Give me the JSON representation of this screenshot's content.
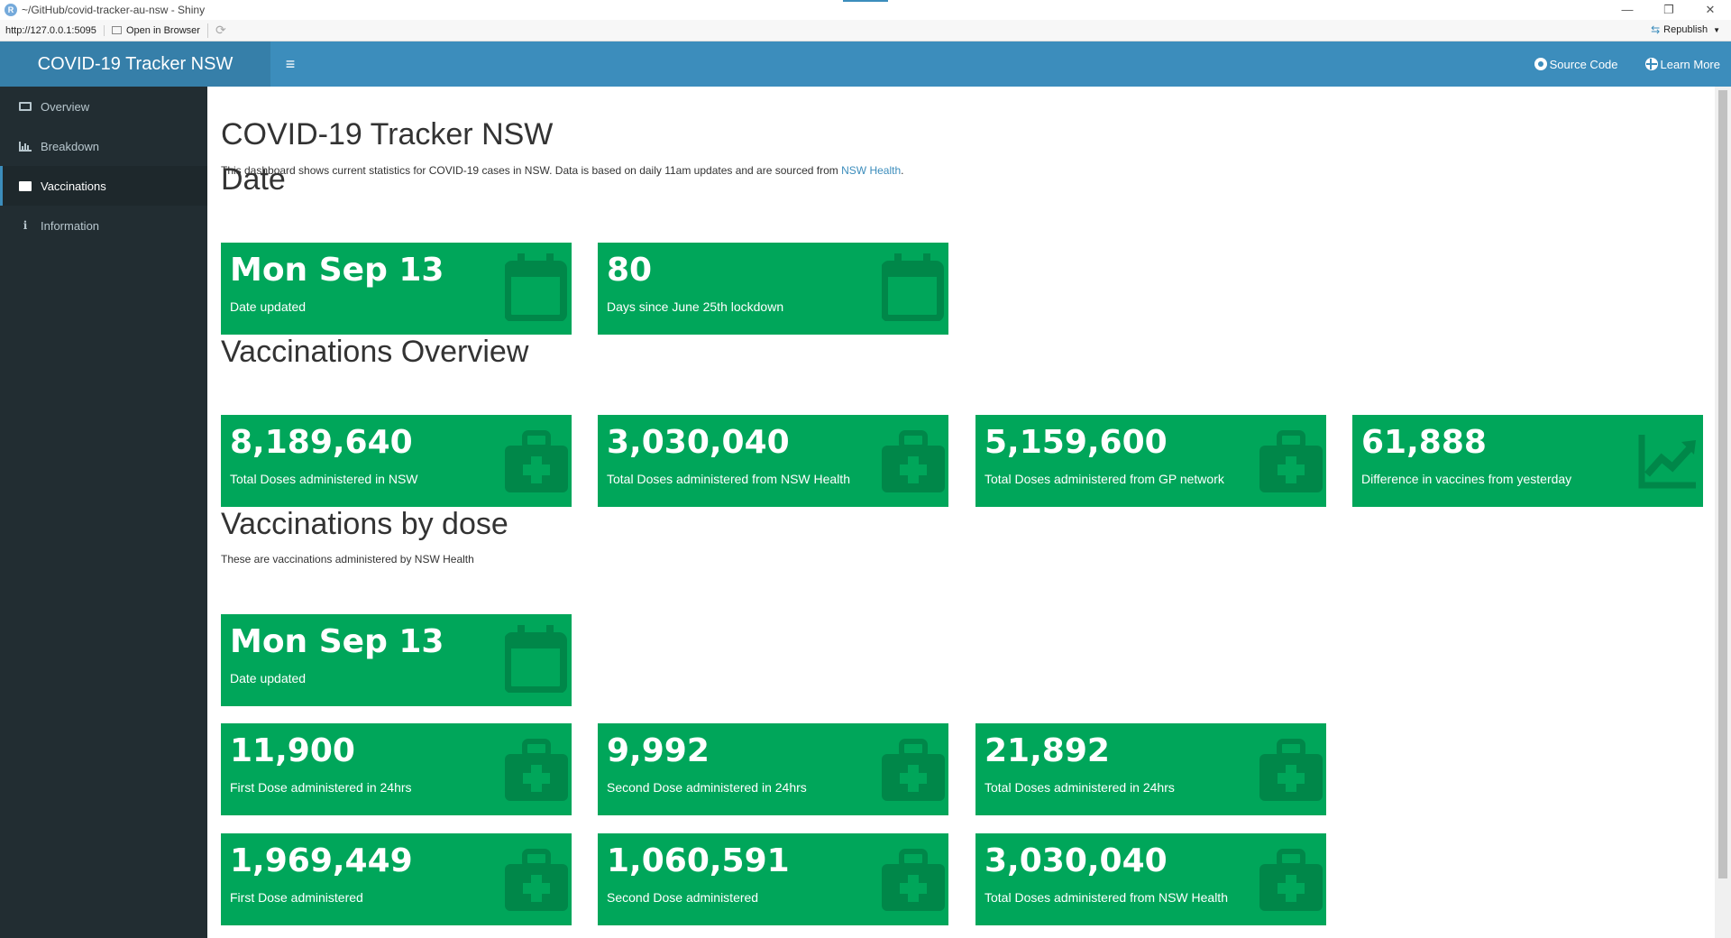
{
  "window": {
    "title": "~/GitHub/covid-tracker-au-nsw - Shiny",
    "url": "http://127.0.0.1:5095",
    "open_browser": "Open in Browser",
    "republish": "Republish",
    "min": "—",
    "restore": "❐",
    "close": "✕"
  },
  "header": {
    "logo": "COVID-19 Tracker NSW",
    "toggle": "≡",
    "links": {
      "source": "Source Code",
      "learn": "Learn More"
    }
  },
  "sidebar": {
    "items": [
      {
        "label": "Overview",
        "icon": "monitor-icon"
      },
      {
        "label": "Breakdown",
        "icon": "bar-chart-icon"
      },
      {
        "label": "Vaccinations",
        "icon": "medkit-icon",
        "active": true
      },
      {
        "label": "Information",
        "icon": "info-icon"
      }
    ]
  },
  "main": {
    "title": "COVID-19 Tracker NSW",
    "intro_text": "This dashboard shows current statistics for COVID-19 cases in NSW. Data is based on daily 11am updates and are sourced from",
    "intro_link": "NSW Health",
    "intro_end": ".",
    "date_section": {
      "heading": "Date",
      "boxes": [
        {
          "value": "Mon Sep 13",
          "label": "Date updated",
          "icon": "calendar-icon"
        },
        {
          "value": "80",
          "label": "Days since June 25th lockdown",
          "icon": "calendar-icon"
        }
      ]
    },
    "overview_section": {
      "heading": "Vaccinations Overview",
      "boxes": [
        {
          "value": "8,189,640",
          "label": "Total Doses administered in NSW",
          "icon": "medkit-icon"
        },
        {
          "value": "3,030,040",
          "label": "Total Doses administered from NSW Health",
          "icon": "medkit-icon"
        },
        {
          "value": "5,159,600",
          "label": "Total Doses administered from GP network",
          "icon": "medkit-icon"
        },
        {
          "value": "61,888",
          "label": "Difference in vaccines from yesterday",
          "icon": "line-chart-icon"
        }
      ]
    },
    "dose_section": {
      "heading": "Vaccinations by dose",
      "note": "These are vaccinations administered by NSW Health",
      "date_box": {
        "value": "Mon Sep 13",
        "label": "Date updated",
        "icon": "calendar-icon"
      },
      "boxes_24h": [
        {
          "value": "11,900",
          "label": "First Dose administered in 24hrs",
          "icon": "medkit-icon"
        },
        {
          "value": "9,992",
          "label": "Second Dose administered in 24hrs",
          "icon": "medkit-icon"
        },
        {
          "value": "21,892",
          "label": "Total Doses administered in 24hrs",
          "icon": "medkit-icon"
        }
      ],
      "boxes_total": [
        {
          "value": "1,969,449",
          "label": "First Dose administered",
          "icon": "medkit-icon"
        },
        {
          "value": "1,060,591",
          "label": "Second Dose administered",
          "icon": "medkit-icon"
        },
        {
          "value": "3,030,040",
          "label": "Total Doses administered from NSW Health",
          "icon": "medkit-icon"
        }
      ]
    }
  },
  "colors": {
    "header": "#3c8dbc",
    "logo_bg": "#367fa9",
    "sidebar": "#222d32",
    "box_green": "#00a65a"
  }
}
